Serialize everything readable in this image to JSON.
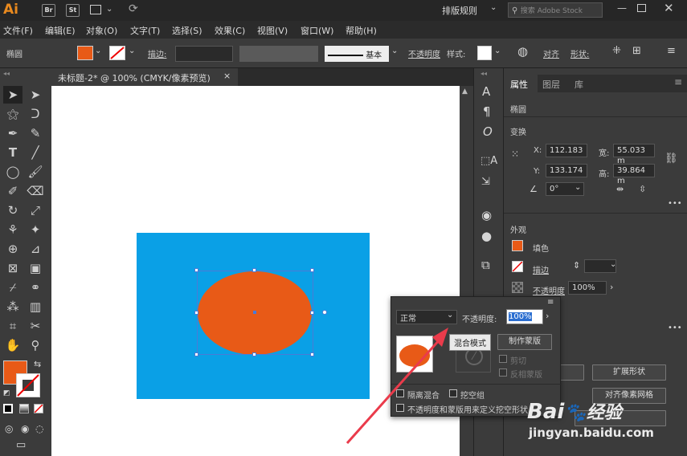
{
  "app": {
    "logo": "Ai",
    "br": "Br",
    "st": "St",
    "workspace": "排版规则",
    "search_placeholder": "搜索 Adobe Stock"
  },
  "menus": [
    "文件(F)",
    "编辑(E)",
    "对象(O)",
    "文字(T)",
    "选择(S)",
    "效果(C)",
    "视图(V)",
    "窗口(W)",
    "帮助(H)"
  ],
  "control": {
    "object_type": "椭圆",
    "stroke_label": "描边:",
    "stroke_style": "基本",
    "opacity_label": "不透明度",
    "style_label": "样式:",
    "align_label": "对齐",
    "shape_label": "形状:"
  },
  "document": {
    "tab_title": "未标题-2* @ 100% (CMYK/像素预览)",
    "close": "×"
  },
  "properties": {
    "tabs": [
      "属性",
      "图层",
      "库"
    ],
    "object_type": "椭圆",
    "transform_title": "变换",
    "x_label": "X:",
    "x_value": "112.183",
    "y_label": "Y:",
    "y_value": "133.174",
    "w_label": "宽:",
    "w_value": "55.033 m",
    "h_label": "高:",
    "h_value": "39.864 m",
    "angle_value": "0°",
    "appearance_title": "外观",
    "fill_label": "填色",
    "stroke_label": "描边",
    "opacity_label": "不透明度",
    "opacity_value": "100%",
    "expand_shape": "扩展形状",
    "align_pixel_grid": "对齐像素网格",
    "more": "•••"
  },
  "transparency_popup": {
    "blend_mode": "正常",
    "opacity_label": "不透明度:",
    "opacity_value": "100%",
    "tooltip": "混合模式",
    "make_mask": "制作蒙版",
    "clip": "剪切",
    "invert_mask": "反相蒙版",
    "isolate_blending": "隔离混合",
    "knockout_group": "挖空组",
    "opacity_mask_define": "不透明度和蒙版用来定义挖空形状"
  },
  "watermark": {
    "brand": "Bai",
    "brand_suffix": "经验",
    "url": "jingyan.baidu.com"
  },
  "colors": {
    "fill": "#e85a17",
    "artboard_rect": "#0aa0e6",
    "accent": "#e8891e"
  }
}
